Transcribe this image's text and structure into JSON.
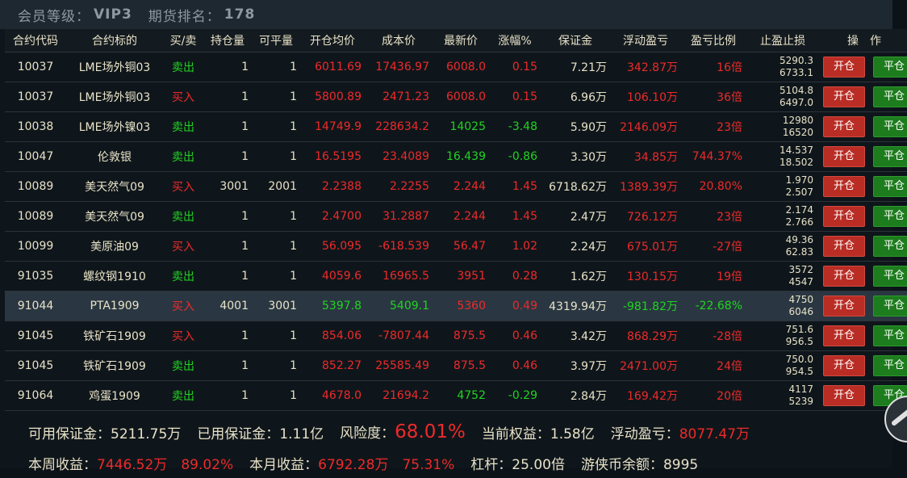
{
  "header": {
    "level_label": "会员等级：",
    "level_value": "VIP3",
    "rank_label": "期货排名：",
    "rank_value": "178"
  },
  "columns": [
    "合约代码",
    "合约标的",
    "买/卖",
    "持仓量",
    "可平量",
    "开仓均价",
    "成本价",
    "最新价",
    "涨幅%",
    "保证金",
    "浮动盈亏",
    "盈亏比例",
    "止盈止损",
    "操　作"
  ],
  "rows": [
    {
      "code": "10037",
      "name": "LME场外铜03",
      "side": "卖出",
      "side_color": "green",
      "hold": "1",
      "closable": "1",
      "open_avg": "6011.69",
      "open_color": "red",
      "cost": "17436.97",
      "cost_color": "red",
      "last": "6008.0",
      "last_color": "red",
      "change": "0.15",
      "change_color": "red",
      "margin": "7.21万",
      "pnl": "342.87万",
      "pnl_color": "red",
      "ratio": "16倍",
      "ratio_color": "red",
      "sl1": "5290.3",
      "sl2": "6733.1"
    },
    {
      "code": "10037",
      "name": "LME场外铜03",
      "side": "买入",
      "side_color": "red",
      "hold": "1",
      "closable": "1",
      "open_avg": "5800.89",
      "open_color": "red",
      "cost": "2471.23",
      "cost_color": "red",
      "last": "6008.0",
      "last_color": "red",
      "change": "0.15",
      "change_color": "red",
      "margin": "6.96万",
      "pnl": "106.10万",
      "pnl_color": "red",
      "ratio": "36倍",
      "ratio_color": "red",
      "sl1": "5104.8",
      "sl2": "6497.0"
    },
    {
      "code": "10038",
      "name": "LME场外镍03",
      "side": "卖出",
      "side_color": "green",
      "hold": "1",
      "closable": "1",
      "open_avg": "14749.9",
      "open_color": "red",
      "cost": "228634.2",
      "cost_color": "red",
      "last": "14025",
      "last_color": "green",
      "change": "-3.48",
      "change_color": "green",
      "margin": "5.90万",
      "pnl": "2146.09万",
      "pnl_color": "red",
      "ratio": "23倍",
      "ratio_color": "red",
      "sl1": "12980",
      "sl2": "16520"
    },
    {
      "code": "10047",
      "name": "伦敦银",
      "side": "卖出",
      "side_color": "green",
      "hold": "1",
      "closable": "1",
      "open_avg": "16.5195",
      "open_color": "red",
      "cost": "23.4089",
      "cost_color": "red",
      "last": "16.439",
      "last_color": "green",
      "change": "-0.86",
      "change_color": "green",
      "margin": "3.30万",
      "pnl": "34.85万",
      "pnl_color": "red",
      "ratio": "744.37%",
      "ratio_color": "red",
      "sl1": "14.537",
      "sl2": "18.502"
    },
    {
      "code": "10089",
      "name": "美天然气09",
      "side": "买入",
      "side_color": "red",
      "hold": "3001",
      "closable": "2001",
      "open_avg": "2.2388",
      "open_color": "red",
      "cost": "2.2255",
      "cost_color": "red",
      "last": "2.244",
      "last_color": "red",
      "change": "1.45",
      "change_color": "red",
      "margin": "6718.62万",
      "pnl": "1389.39万",
      "pnl_color": "red",
      "ratio": "20.80%",
      "ratio_color": "red",
      "sl1": "1.970",
      "sl2": "2.507"
    },
    {
      "code": "10089",
      "name": "美天然气09",
      "side": "卖出",
      "side_color": "green",
      "hold": "1",
      "closable": "1",
      "open_avg": "2.4700",
      "open_color": "red",
      "cost": "31.2887",
      "cost_color": "red",
      "last": "2.244",
      "last_color": "red",
      "change": "1.45",
      "change_color": "red",
      "margin": "2.47万",
      "pnl": "726.12万",
      "pnl_color": "red",
      "ratio": "23倍",
      "ratio_color": "red",
      "sl1": "2.174",
      "sl2": "2.766"
    },
    {
      "code": "10099",
      "name": "美原油09",
      "side": "买入",
      "side_color": "red",
      "hold": "1",
      "closable": "1",
      "open_avg": "56.095",
      "open_color": "red",
      "cost": "-618.539",
      "cost_color": "red",
      "last": "56.47",
      "last_color": "red",
      "change": "1.02",
      "change_color": "red",
      "margin": "2.24万",
      "pnl": "675.01万",
      "pnl_color": "red",
      "ratio": "-27倍",
      "ratio_color": "red",
      "sl1": "49.36",
      "sl2": "62.83"
    },
    {
      "code": "91035",
      "name": "螺纹钢1910",
      "side": "卖出",
      "side_color": "green",
      "hold": "1",
      "closable": "1",
      "open_avg": "4059.6",
      "open_color": "red",
      "cost": "16965.5",
      "cost_color": "red",
      "last": "3951",
      "last_color": "red",
      "change": "0.28",
      "change_color": "red",
      "margin": "1.62万",
      "pnl": "130.15万",
      "pnl_color": "red",
      "ratio": "19倍",
      "ratio_color": "red",
      "sl1": "3572",
      "sl2": "4547"
    },
    {
      "code": "91044",
      "name": "PTA1909",
      "side": "买入",
      "side_color": "red",
      "hold": "4001",
      "closable": "3001",
      "open_avg": "5397.8",
      "open_color": "green",
      "cost": "5409.1",
      "cost_color": "green",
      "last": "5360",
      "last_color": "red",
      "change": "0.49",
      "change_color": "red",
      "margin": "4319.94万",
      "pnl": "-981.82万",
      "pnl_color": "green",
      "ratio": "-22.68%",
      "ratio_color": "green",
      "sl1": "4750",
      "sl2": "6046"
    },
    {
      "code": "91045",
      "name": "铁矿石1909",
      "side": "买入",
      "side_color": "red",
      "hold": "1",
      "closable": "1",
      "open_avg": "854.06",
      "open_color": "red",
      "cost": "-7807.44",
      "cost_color": "red",
      "last": "875.5",
      "last_color": "red",
      "change": "0.46",
      "change_color": "red",
      "margin": "3.42万",
      "pnl": "868.29万",
      "pnl_color": "red",
      "ratio": "-28倍",
      "ratio_color": "red",
      "sl1": "751.6",
      "sl2": "956.5"
    },
    {
      "code": "91045",
      "name": "铁矿石1909",
      "side": "卖出",
      "side_color": "green",
      "hold": "1",
      "closable": "1",
      "open_avg": "852.27",
      "open_color": "red",
      "cost": "25585.49",
      "cost_color": "red",
      "last": "875.5",
      "last_color": "red",
      "change": "0.46",
      "change_color": "red",
      "margin": "3.97万",
      "pnl": "2471.00万",
      "pnl_color": "red",
      "ratio": "24倍",
      "ratio_color": "red",
      "sl1": "750.0",
      "sl2": "954.5"
    },
    {
      "code": "91064",
      "name": "鸡蛋1909",
      "side": "卖出",
      "side_color": "green",
      "hold": "1",
      "closable": "1",
      "open_avg": "4678.0",
      "open_color": "red",
      "cost": "21694.2",
      "cost_color": "red",
      "last": "4752",
      "last_color": "green",
      "change": "-0.29",
      "change_color": "green",
      "margin": "2.84万",
      "pnl": "169.42万",
      "pnl_color": "red",
      "ratio": "20倍",
      "ratio_color": "red",
      "sl1": "4117",
      "sl2": "5239"
    }
  ],
  "buttons": {
    "open": "开仓",
    "close": "平仓"
  },
  "summary": {
    "available_margin_label": "可用保证金：",
    "available_margin": "5211.75万",
    "used_margin_label": "已用保证金：",
    "used_margin": "1.11亿",
    "risk_label": "风险度：",
    "risk": "68.01%",
    "equity_label": "当前权益：",
    "equity": "1.58亿",
    "float_pnl_label": "浮动盈亏：",
    "float_pnl": "8077.47万",
    "week_label": "本周收益：",
    "week_value": "7446.52万",
    "week_pct": "89.02%",
    "month_label": "本月收益：",
    "month_value": "6792.28万",
    "month_pct": "75.31%",
    "leverage_label": "杠杆：",
    "leverage": "25.00倍",
    "coin_label": "游侠币余额：",
    "coin": "8995"
  },
  "colors": {
    "red": "#ee2a2a",
    "green": "#20d420",
    "cream": "#e8e2c8",
    "header_bg": "#1e2830",
    "highlight_row": "#2a3742",
    "open_btn": "#b92d25",
    "close_btn": "#1d7c1d"
  },
  "icons": {
    "scroll": "scroll-up-icon"
  },
  "highlighted_row": 8
}
